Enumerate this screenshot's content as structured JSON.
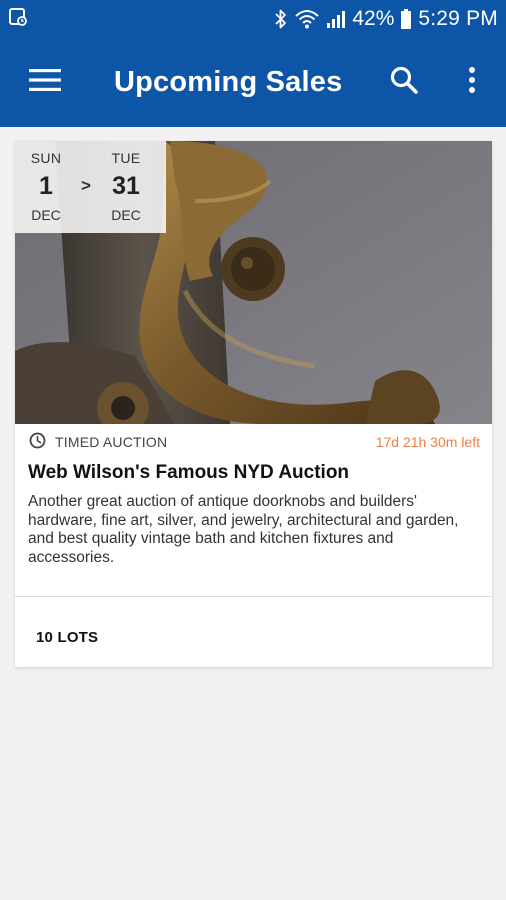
{
  "status_bar": {
    "battery_percent": "42%",
    "time": "5:29 PM"
  },
  "app_bar": {
    "title": "Upcoming Sales"
  },
  "sale": {
    "start": {
      "weekday": "SUN",
      "day": "1",
      "month": "DEC"
    },
    "date_separator": ">",
    "end": {
      "weekday": "TUE",
      "day": "31",
      "month": "DEC"
    },
    "type": "TIMED AUCTION",
    "time_left": "17d 21h 30m left",
    "title": "Web Wilson's Famous NYD Auction",
    "description": "Another great auction of antique doorknobs and builders' hardware, fine art, silver, and jewelry, architectural and garden, and best quality vintage bath and kitchen fixtures and accessories.",
    "lots": "10 LOTS"
  },
  "colors": {
    "primary": "#0d55a6",
    "time_left": "#f07d44",
    "background": "#f2f1ef"
  },
  "icons": [
    "screenshot-icon",
    "bluetooth-icon",
    "wifi-icon",
    "signal-icon",
    "battery-icon",
    "menu-icon",
    "search-icon",
    "more-vert-icon",
    "clock-icon"
  ]
}
